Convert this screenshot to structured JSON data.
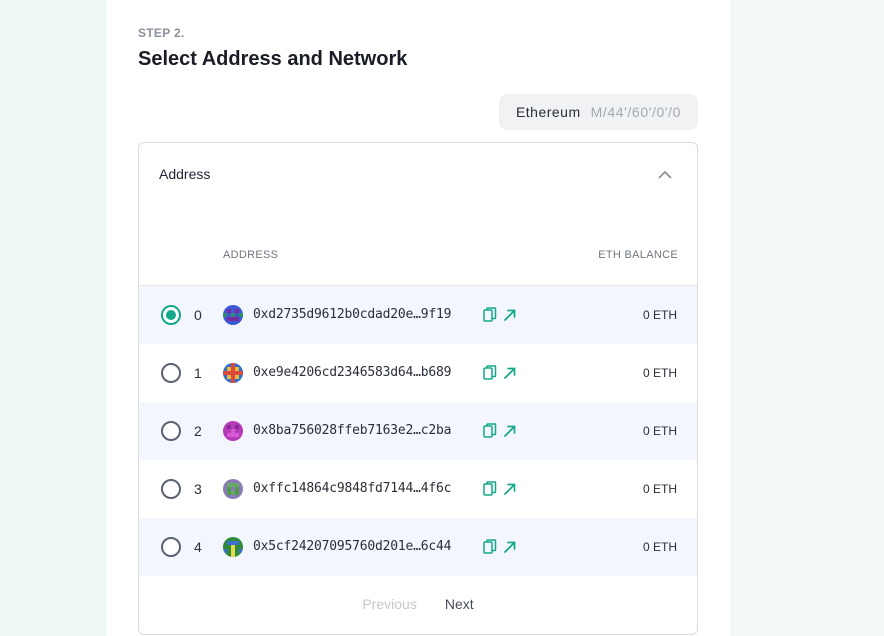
{
  "step": {
    "label": "STEP 2.",
    "title": "Select Address and Network"
  },
  "network": {
    "name": "Ethereum",
    "path": "M/44'/60'/0'/0"
  },
  "card": {
    "title": "Address",
    "columns": {
      "address": "ADDRESS",
      "balance": "ETH BALANCE"
    }
  },
  "rows": [
    {
      "index": "0",
      "address": "0xd2735d9612b0cdad20e…9f19",
      "balance": "0 ETH",
      "selected": true,
      "avatar": [
        "#3a5bd8",
        "#7a2b9e",
        "#2f8f6b"
      ]
    },
    {
      "index": "1",
      "address": "0xe9e4206cd2346583d64…b689",
      "balance": "0 ETH",
      "selected": false,
      "avatar": [
        "#d94a3a",
        "#2f6fd0",
        "#e8b93a"
      ]
    },
    {
      "index": "2",
      "address": "0x8ba756028ffeb7163e2…c2ba",
      "balance": "0 ETH",
      "selected": false,
      "avatar": [
        "#b43ab8",
        "#8a2a9a",
        "#d65ad2"
      ]
    },
    {
      "index": "3",
      "address": "0xffc14864c9848fd7144…4f6c",
      "balance": "0 ETH",
      "selected": false,
      "avatar": [
        "#6aa86a",
        "#8a7ab8",
        "#4f9a4f"
      ]
    },
    {
      "index": "4",
      "address": "0x5cf24207095760d201e…6c44",
      "balance": "0 ETH",
      "selected": false,
      "avatar": [
        "#2f8a3a",
        "#3a6fd0",
        "#e6d84a"
      ]
    }
  ],
  "pager": {
    "previous": "Previous",
    "next": "Next"
  },
  "icons": {
    "collapse": "chevron-up-icon",
    "copy": "copy-icon",
    "explorer": "external-link-icon"
  },
  "colors": {
    "accent": "#14a88b",
    "row_shade": "#f3f6fd",
    "background": "#eef8f6"
  }
}
